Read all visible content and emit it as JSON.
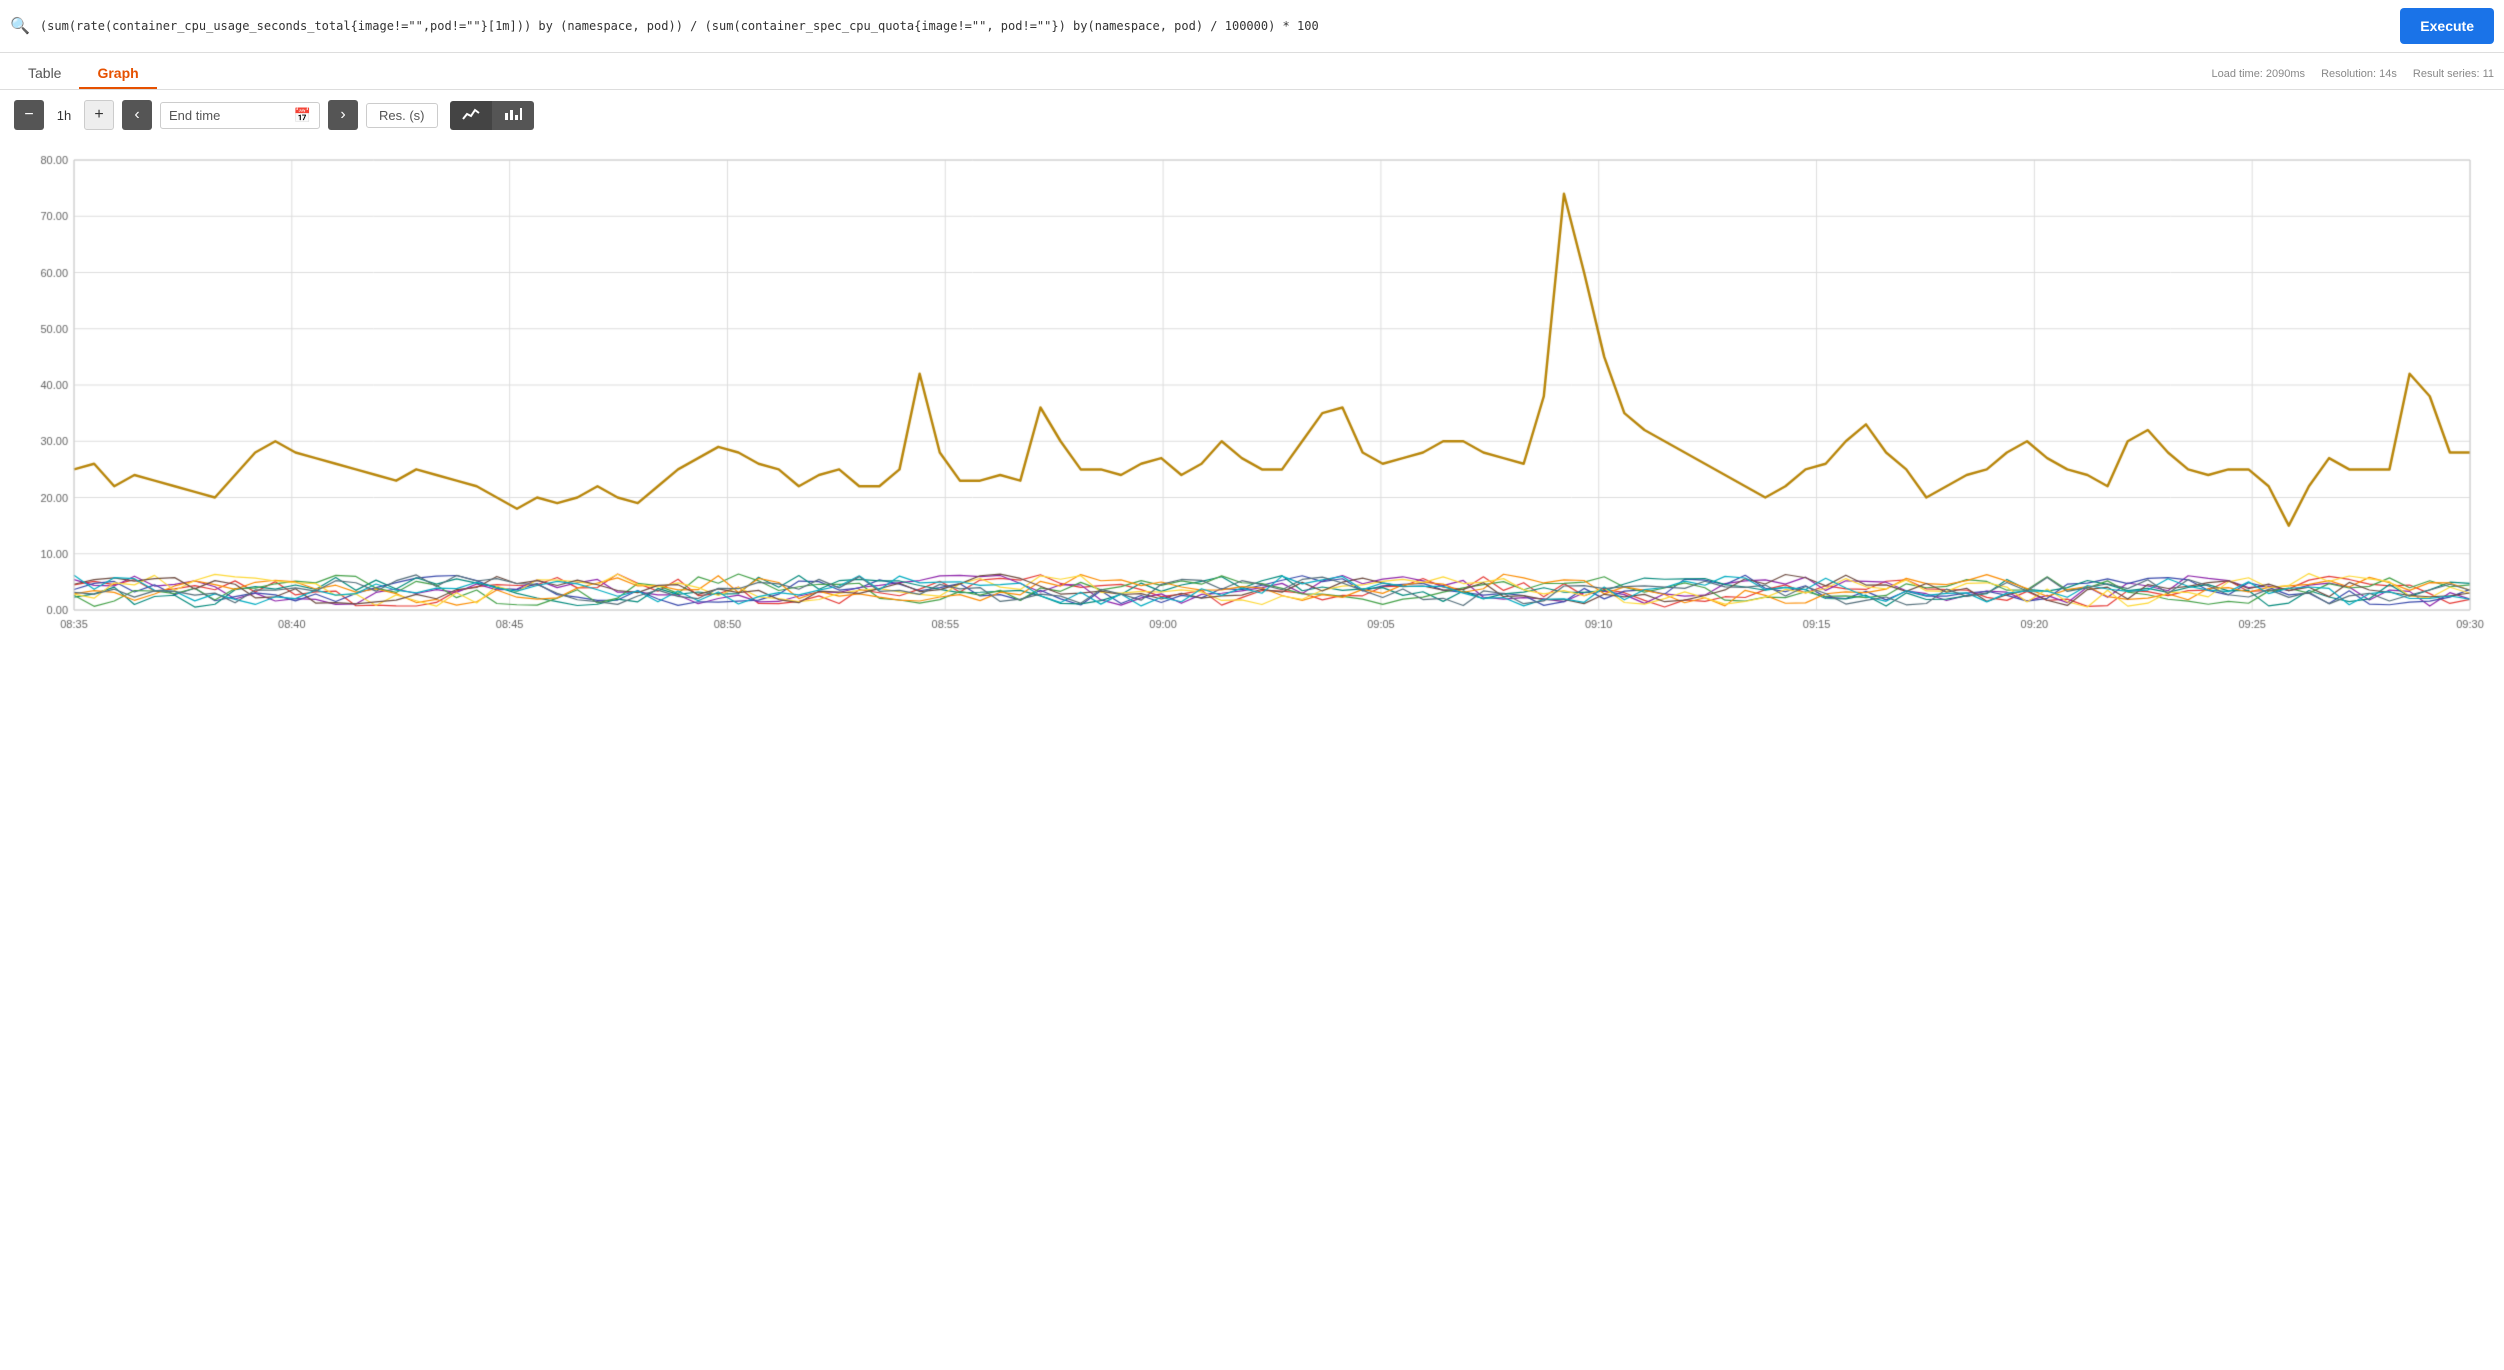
{
  "query": {
    "text": "(sum(rate(container_cpu_usage_seconds_total{image!=\"\",pod!=\"\"}[1m])) by (namespace, pod)) / (sum(container_spec_cpu_quota{image!=\"\", pod!=\"\"}) by(namespace, pod) / 100000) * 100",
    "execute_label": "Execute"
  },
  "tabs": {
    "items": [
      "Table",
      "Graph"
    ],
    "active": "Graph"
  },
  "meta": {
    "load_time": "Load time: 2090ms",
    "resolution": "Resolution: 14s",
    "result_series": "Result series: 11"
  },
  "controls": {
    "minus_label": "−",
    "duration": "1h",
    "plus_label": "+",
    "prev_label": "‹",
    "end_time_placeholder": "End time",
    "next_label": "›",
    "resolution_label": "Res. (s)",
    "chart_line_label": "📈",
    "chart_bar_label": "📊"
  },
  "chart": {
    "y_labels": [
      "80.00",
      "70.00",
      "60.00",
      "50.00",
      "40.00",
      "30.00",
      "20.00",
      "10.00",
      "0.00"
    ],
    "x_labels": [
      "08:35",
      "08:40",
      "08:45",
      "08:50",
      "08:55",
      "09:00",
      "09:05",
      "09:10",
      "09:15",
      "09:20",
      "09:25",
      "09:30"
    ]
  }
}
